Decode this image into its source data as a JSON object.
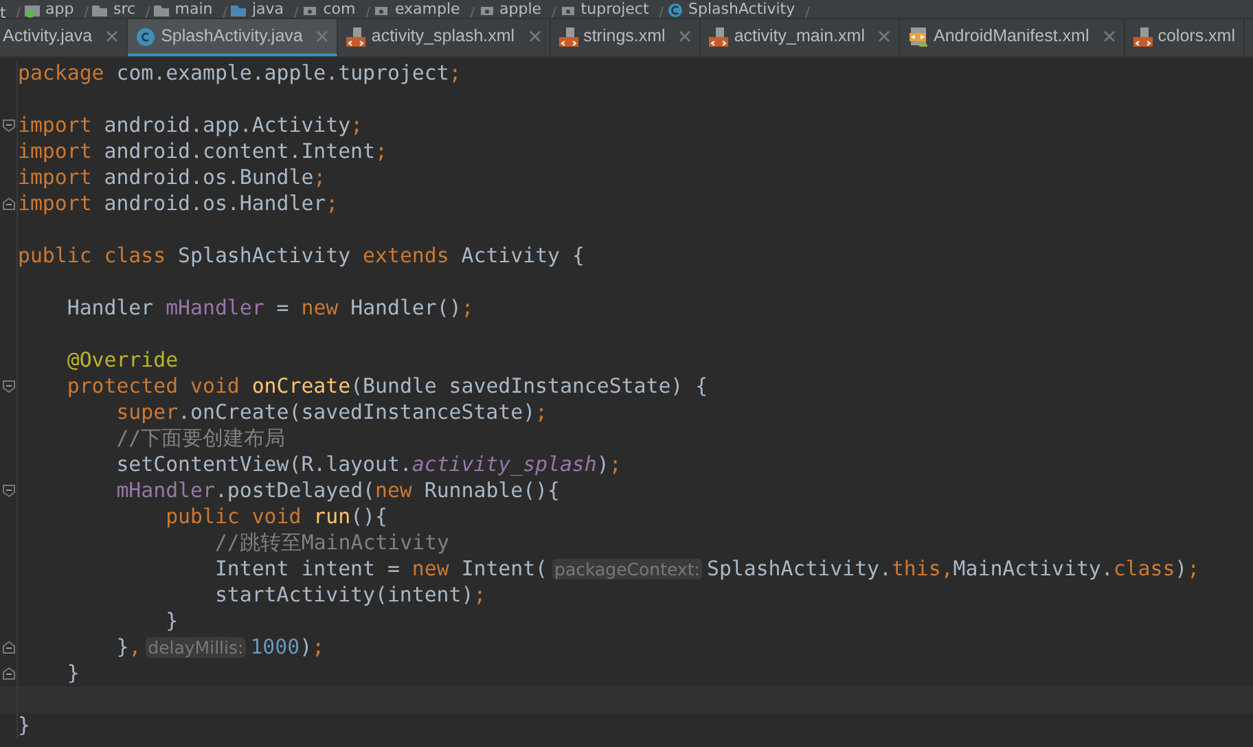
{
  "breadcrumb": [
    {
      "label": "t",
      "kind": "none",
      "separator": "/"
    },
    {
      "label": "app",
      "kind": "module",
      "separator": "/"
    },
    {
      "label": "src",
      "kind": "folder",
      "separator": "/"
    },
    {
      "label": "main",
      "kind": "folder",
      "separator": "/"
    },
    {
      "label": "java",
      "kind": "source",
      "separator": "/"
    },
    {
      "label": "com",
      "kind": "package",
      "separator": "/"
    },
    {
      "label": "example",
      "kind": "package",
      "separator": "/"
    },
    {
      "label": "apple",
      "kind": "package",
      "separator": "/"
    },
    {
      "label": "tuproject",
      "kind": "package",
      "separator": "/"
    },
    {
      "label": "SplashActivity",
      "kind": "class",
      "separator": "/"
    }
  ],
  "tabs": [
    {
      "label": "Activity.java",
      "kind": "none",
      "selected": false,
      "closable": true
    },
    {
      "label": "SplashActivity.java",
      "kind": "class",
      "selected": true,
      "closable": true
    },
    {
      "label": "activity_splash.xml",
      "kind": "layout",
      "selected": false,
      "closable": true
    },
    {
      "label": "strings.xml",
      "kind": "layout",
      "selected": false,
      "closable": true
    },
    {
      "label": "activity_main.xml",
      "kind": "layout",
      "selected": false,
      "closable": true
    },
    {
      "label": "AndroidManifest.xml",
      "kind": "manifest",
      "selected": false,
      "closable": true
    },
    {
      "label": "colors.xml",
      "kind": "layout",
      "selected": false,
      "closable": false
    }
  ],
  "code_lines": [
    {
      "kind": "plain",
      "tokens": [
        {
          "kind": "kw",
          "text": "package"
        },
        {
          "kind": "plain",
          "text": " com.example.apple.tuproject"
        },
        {
          "kind": "kw",
          "text": ";"
        }
      ]
    },
    {
      "kind": "plain"
    },
    {
      "kind": "fold-start",
      "tokens": [
        {
          "kind": "kw",
          "text": "import"
        },
        {
          "kind": "plain",
          "text": " android.app.Activity"
        },
        {
          "kind": "kw",
          "text": ";"
        }
      ]
    },
    {
      "kind": "plain",
      "tokens": [
        {
          "kind": "kw",
          "text": "import"
        },
        {
          "kind": "plain",
          "text": " android.content.Intent"
        },
        {
          "kind": "kw",
          "text": ";"
        }
      ]
    },
    {
      "kind": "plain",
      "tokens": [
        {
          "kind": "kw",
          "text": "import"
        },
        {
          "kind": "plain",
          "text": " android.os.Bundle"
        },
        {
          "kind": "kw",
          "text": ";"
        }
      ]
    },
    {
      "kind": "fold-end",
      "tokens": [
        {
          "kind": "kw",
          "text": "import"
        },
        {
          "kind": "plain",
          "text": " android.os.Handler"
        },
        {
          "kind": "kw",
          "text": ";"
        }
      ]
    },
    {
      "kind": "plain"
    },
    {
      "kind": "plain",
      "tokens": [
        {
          "kind": "kw",
          "text": "public class"
        },
        {
          "kind": "plain",
          "text": " SplashActivity "
        },
        {
          "kind": "kw",
          "text": "extends"
        },
        {
          "kind": "plain",
          "text": " Activity {"
        }
      ]
    },
    {
      "kind": "plain"
    },
    {
      "kind": "plain",
      "tokens": [
        {
          "kind": "plain",
          "text": "    Handler "
        },
        {
          "kind": "field",
          "text": "mHandler"
        },
        {
          "kind": "plain",
          "text": " = "
        },
        {
          "kind": "kw",
          "text": "new"
        },
        {
          "kind": "plain",
          "text": " Handler()"
        },
        {
          "kind": "kw",
          "text": ";"
        }
      ]
    },
    {
      "kind": "plain"
    },
    {
      "kind": "plain",
      "tokens": [
        {
          "kind": "annotation",
          "text": "    @Override"
        }
      ]
    },
    {
      "kind": "fold-start",
      "tokens": [
        {
          "kind": "kw",
          "text": "    protected void "
        },
        {
          "kind": "method",
          "text": "onCreate"
        },
        {
          "kind": "plain",
          "text": "(Bundle savedInstanceState) {"
        }
      ]
    },
    {
      "kind": "plain",
      "tokens": [
        {
          "kind": "kw",
          "text": "        super"
        },
        {
          "kind": "plain",
          "text": ".onCreate(savedInstanceState)"
        },
        {
          "kind": "kw",
          "text": ";"
        }
      ]
    },
    {
      "kind": "plain",
      "tokens": [
        {
          "kind": "comment",
          "text": "        //下面要创建布局"
        }
      ]
    },
    {
      "kind": "plain",
      "tokens": [
        {
          "kind": "plain",
          "text": "        setContentView(R.layout."
        },
        {
          "kind": "static",
          "text": "activity_splash"
        },
        {
          "kind": "plain",
          "text": ")"
        },
        {
          "kind": "kw",
          "text": ";"
        }
      ]
    },
    {
      "kind": "fold-start",
      "tokens": [
        {
          "kind": "field",
          "text": "        mHandler"
        },
        {
          "kind": "plain",
          "text": ".postDelayed("
        },
        {
          "kind": "kw",
          "text": "new"
        },
        {
          "kind": "plain",
          "text": " Runnable(){"
        }
      ]
    },
    {
      "kind": "plain",
      "tokens": [
        {
          "kind": "kw",
          "text": "            public void "
        },
        {
          "kind": "method",
          "text": "run"
        },
        {
          "kind": "plain",
          "text": "(){"
        }
      ]
    },
    {
      "kind": "plain",
      "tokens": [
        {
          "kind": "comment",
          "text": "                //跳转至MainActivity"
        }
      ]
    },
    {
      "kind": "plain",
      "tokens": [
        {
          "kind": "plain",
          "text": "                Intent intent = "
        },
        {
          "kind": "kw",
          "text": "new"
        },
        {
          "kind": "plain",
          "text": " Intent("
        },
        {
          "kind": "hint",
          "text": "packageContext:"
        },
        {
          "kind": "plain",
          "text": "SplashActivity."
        },
        {
          "kind": "kw",
          "text": "this,"
        },
        {
          "kind": "plain",
          "text": "MainActivity."
        },
        {
          "kind": "kw",
          "text": "class"
        },
        {
          "kind": "plain",
          "text": ")"
        },
        {
          "kind": "kw",
          "text": ";"
        }
      ]
    },
    {
      "kind": "plain",
      "tokens": [
        {
          "kind": "plain",
          "text": "                startActivity(intent)"
        },
        {
          "kind": "kw",
          "text": ";"
        }
      ]
    },
    {
      "kind": "plain",
      "tokens": [
        {
          "kind": "plain",
          "text": "            }"
        }
      ]
    },
    {
      "kind": "fold-end",
      "tokens": [
        {
          "kind": "plain",
          "text": "        }"
        },
        {
          "kind": "kw",
          "text": ","
        },
        {
          "kind": "hint",
          "text": "delayMillis:"
        },
        {
          "kind": "number",
          "text": "1000"
        },
        {
          "kind": "plain",
          "text": ")"
        },
        {
          "kind": "kw",
          "text": ";"
        }
      ]
    },
    {
      "kind": "fold-end",
      "tokens": [
        {
          "kind": "plain",
          "text": "    }"
        }
      ]
    },
    {
      "kind": "current"
    },
    {
      "kind": "plain",
      "tokens": [
        {
          "kind": "plain",
          "text": "}"
        }
      ]
    }
  ]
}
